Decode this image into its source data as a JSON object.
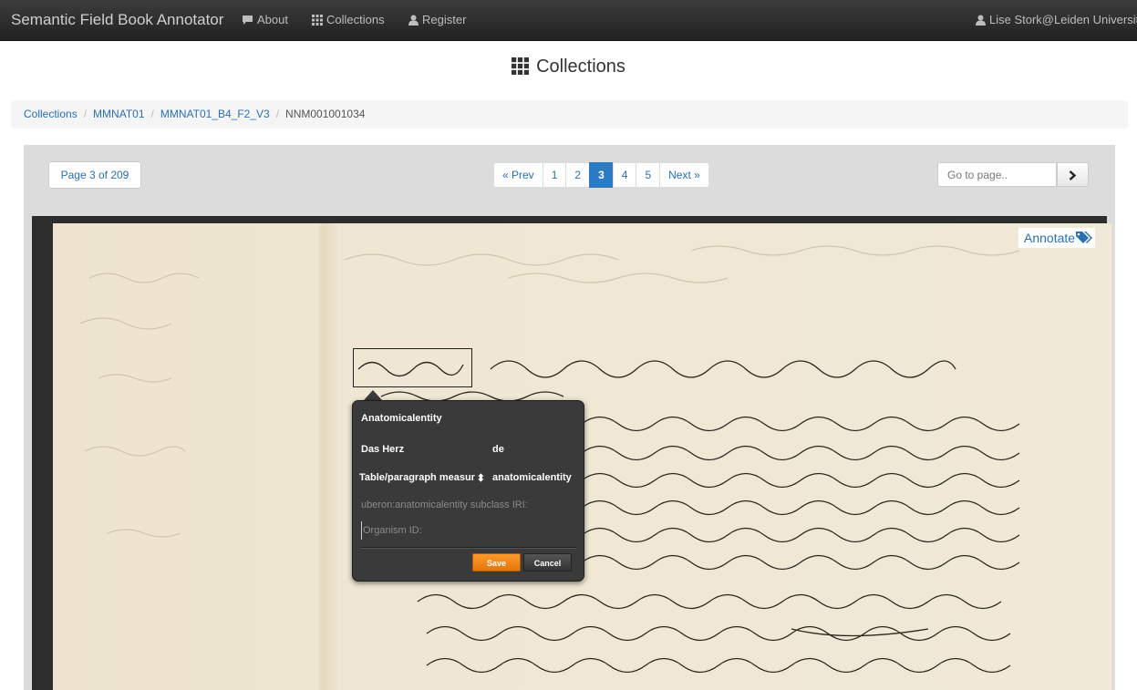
{
  "navbar": {
    "brand": "Semantic Field Book Annotator",
    "items": [
      {
        "label": "About",
        "icon": "comment-icon"
      },
      {
        "label": "Collections",
        "icon": "grid-icon"
      },
      {
        "label": "Register",
        "icon": "user-icon"
      }
    ],
    "user": {
      "label": "Lise Stork@Leiden University",
      "icon": "user-icon"
    }
  },
  "page_title": "Collections",
  "breadcrumb": {
    "items": [
      "Collections",
      "MMNAT01",
      "MMNAT01_B4_F2_V3"
    ],
    "current": "NNM001001034",
    "separator": "/"
  },
  "pagination": {
    "page_indicator": "Page 3 of 209",
    "prev": "« Prev",
    "pages": [
      "1",
      "2",
      "3",
      "4",
      "5"
    ],
    "current_page": "3",
    "next": "Next »",
    "goto_placeholder": "Go to page.."
  },
  "viewer": {
    "annotate_label": "Annotate"
  },
  "popup": {
    "title": "Anatomicalentity",
    "term": "Das Herz",
    "language": "de",
    "select_value": "Table/paragraph measurement",
    "select_caret": "⬍",
    "entity_type": "anatomicalentity",
    "iri_placeholder": "uberon:anatomicalentity subclass IRI:",
    "organism_placeholder": "Organism ID:",
    "save_label": "Save",
    "cancel_label": "Cancel"
  },
  "colors": {
    "navbar": "#2a2a2a",
    "link": "#2a6fb5",
    "active_page": "#2a7ac4",
    "save": "#f28a1a",
    "popup": "#3a3a3a"
  }
}
